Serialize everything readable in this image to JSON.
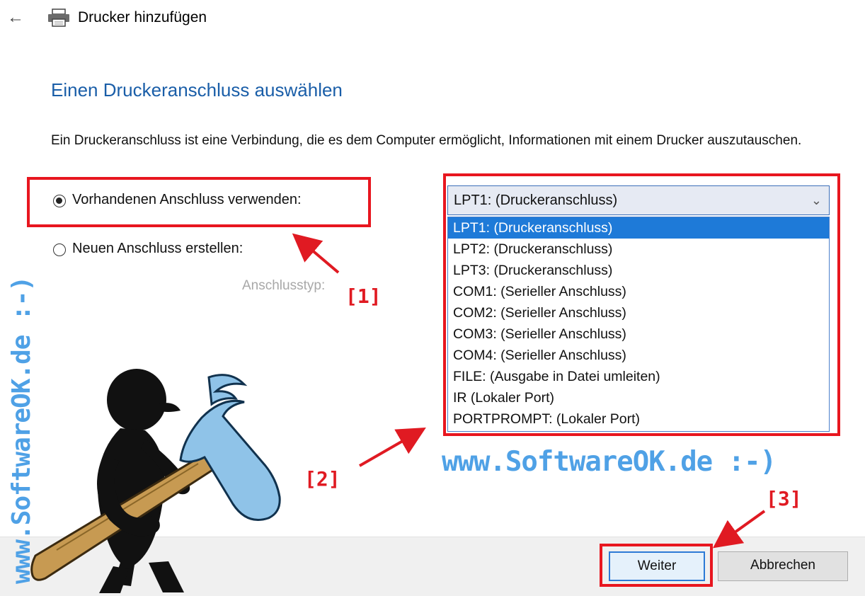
{
  "window": {
    "title": "Drucker hinzufügen",
    "back_icon": "back-arrow-icon",
    "app_icon": "printer-icon"
  },
  "page": {
    "title": "Einen Druckeranschluss auswählen",
    "description": "Ein Druckeranschluss ist eine Verbindung, die es dem Computer ermöglicht, Informationen mit einem Drucker auszutauschen."
  },
  "options": {
    "existing_port_label": "Vorhandenen Anschluss verwenden:",
    "existing_port_checked": true,
    "new_port_label": "Neuen Anschluss erstellen:",
    "new_port_checked": false,
    "port_type_label": "Anschlusstyp:"
  },
  "port_select": {
    "selected": "LPT1: (Druckeranschluss)",
    "options": [
      "LPT1: (Druckeranschluss)",
      "LPT2: (Druckeranschluss)",
      "LPT3: (Druckeranschluss)",
      "COM1: (Serieller Anschluss)",
      "COM2: (Serieller Anschluss)",
      "COM3: (Serieller Anschluss)",
      "COM4: (Serieller Anschluss)",
      "FILE: (Ausgabe in Datei umleiten)",
      "IR (Lokaler Port)",
      "PORTPROMPT: (Lokaler Port)"
    ],
    "highlighted_index": 0
  },
  "buttons": {
    "next": "Weiter",
    "cancel": "Abbrechen"
  },
  "annotations": {
    "marker1": "[1]",
    "marker2": "[2]",
    "marker3": "[3]",
    "color": "#e01a22"
  },
  "watermark": {
    "horizontal": "www.SoftwareOK.de :-)",
    "vertical": "www.SoftwareOK.de :-)",
    "color": "#4fa1e6"
  },
  "colors": {
    "title_blue": "#1a5ea8",
    "selection_blue": "#1e7ad8",
    "highlight_red": "#e8161f"
  }
}
